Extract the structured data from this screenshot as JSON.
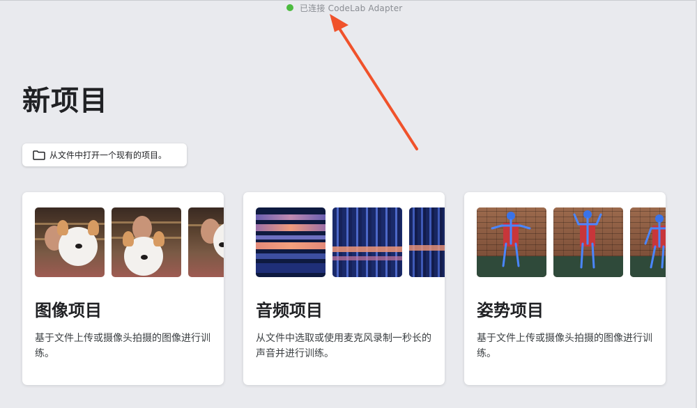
{
  "status": {
    "text": "已连接 CodeLab Adapter",
    "color": "#4cbb3f"
  },
  "page": {
    "title": "新项目"
  },
  "open_file": {
    "label": "从文件中打开一个现有的项目。",
    "icon": "folder-icon"
  },
  "cards": [
    {
      "id": "image",
      "title": "图像项目",
      "desc": "基于文件上传或摄像头拍摄的图像进行训练。"
    },
    {
      "id": "audio",
      "title": "音频项目",
      "desc": "从文件中选取或使用麦克风录制一秒长的声音并进行训练。"
    },
    {
      "id": "pose",
      "title": "姿势项目",
      "desc": "基于文件上传或摄像头拍摄的图像进行训练。"
    }
  ],
  "annotation": {
    "arrow_color": "#f0522b",
    "icon": "arrow-annotation"
  }
}
